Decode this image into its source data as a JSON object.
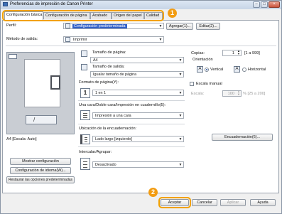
{
  "window": {
    "title": "Preferencias de impresión de Canon Printer"
  },
  "tabs": [
    {
      "label": "Configuración básica"
    },
    {
      "label": "Configuración de página"
    },
    {
      "label": "Acabado"
    },
    {
      "label": "Origen del papel"
    },
    {
      "label": "Calidad"
    }
  ],
  "callouts": {
    "one": "1",
    "two": "2"
  },
  "profile": {
    "label": "Perfil:",
    "value": "Configuración predeterminada",
    "add_button": "Agregar(1)...",
    "edit_button": "Editar(2)..."
  },
  "output_method": {
    "label": "Método de salida:",
    "value": "Imprimir"
  },
  "page_size": {
    "label": "Tamaño de página:",
    "value": "A4"
  },
  "output_size": {
    "label": "Tamaño de salida:",
    "value": "Igualar tamaño de página"
  },
  "copies": {
    "label": "Copias:",
    "value": "1",
    "range": "[1 a 999]"
  },
  "orientation": {
    "label": "Orientación",
    "vertical": "Vertical",
    "horizontal": "Horizontal",
    "icon_letter": "A"
  },
  "manual_scale": {
    "label": "Escala manual",
    "scale_label": "Escala:",
    "scale_value": "100",
    "scale_range": "% [25 a 200]"
  },
  "page_layout": {
    "label": "Formato de página(Y):",
    "icon_number": "1",
    "value": "1 en 1"
  },
  "duplex": {
    "label": "Una cara/Doble cara/Impresión en cuadernillo(5):",
    "value": "Impresión a una cara"
  },
  "binding": {
    "label": "Ubicación de la encuadernación:",
    "value": "Lado largo [izquierdo]",
    "button": "Encuadernación(6)..."
  },
  "collate": {
    "label": "Intercalar/Agrupar:",
    "value": "Desactivado"
  },
  "preview": {
    "caption": "A4 [Escala: Auto]",
    "icon_label": "/ "
  },
  "left_buttons": {
    "show_config": "Mostrar configuración",
    "lang_config": "Configuración de idioma(W)...",
    "restore": "Restaurar las opciones predeterminadas"
  },
  "footer": {
    "ok": "Aceptar",
    "cancel": "Cancelar",
    "apply": "Aplicar",
    "help": "Ayuda"
  }
}
